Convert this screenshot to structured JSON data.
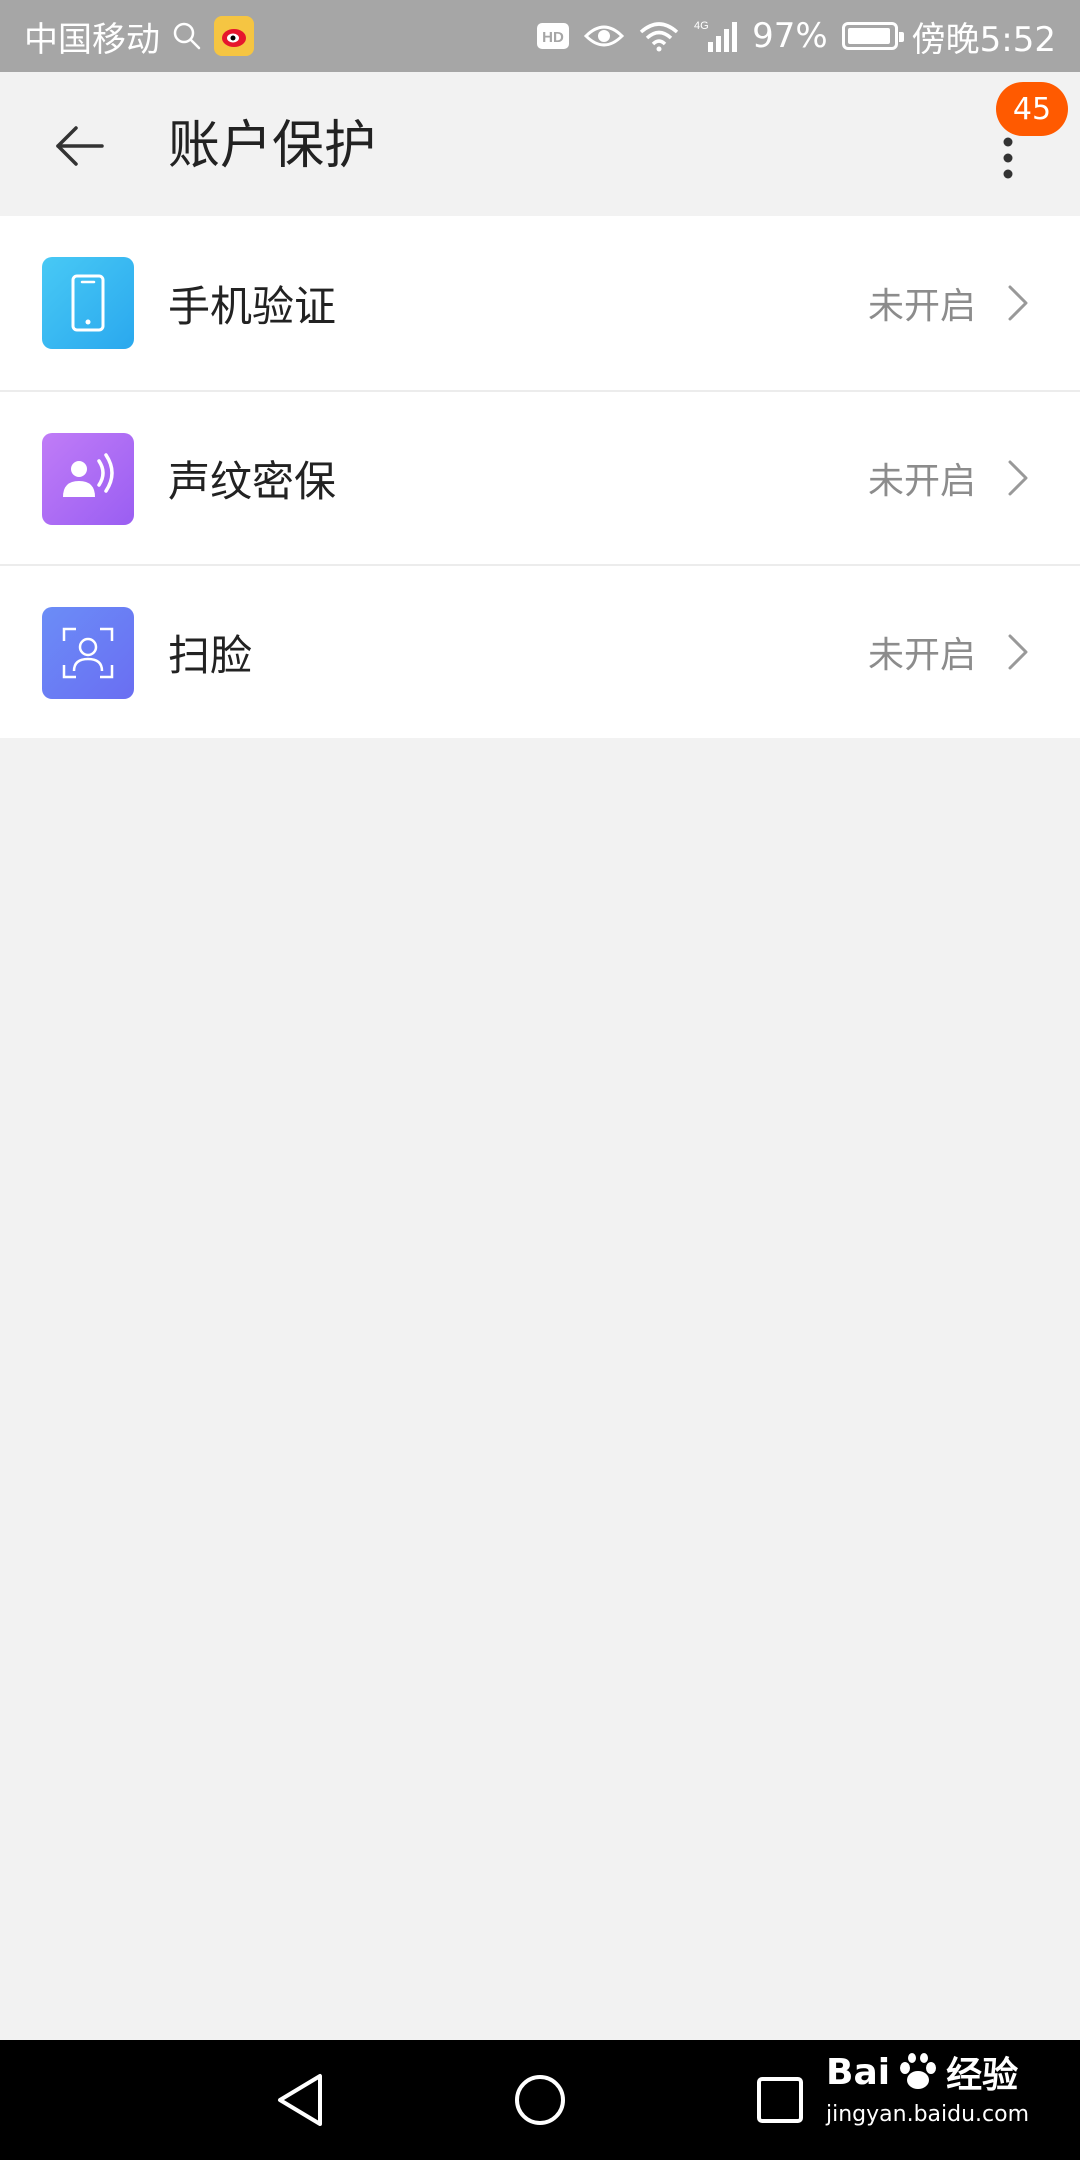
{
  "status_bar": {
    "carrier": "中国移动",
    "hd_label": "HD",
    "network": "4G",
    "battery": "97%",
    "battery_level": 0.97,
    "time": "傍晚5:52"
  },
  "header": {
    "title": "账户保护",
    "badge_count": "45"
  },
  "items": [
    {
      "label": "手机验证",
      "status": "未开启",
      "icon": "phone-icon",
      "color": "#3cb9f0"
    },
    {
      "label": "声纹密保",
      "status": "未开启",
      "icon": "voiceprint-icon",
      "color": "#a067f5"
    },
    {
      "label": "扫脸",
      "status": "未开启",
      "icon": "face-scan-icon",
      "color": "#6a7ef5"
    }
  ],
  "watermark": {
    "brand": "Bai",
    "brand_suffix": "经验",
    "url": "jingyan.baidu.com"
  },
  "colors": {
    "badge": "#ff5a00",
    "background": "#f2f2f2",
    "status_bar": "#a6a6a6"
  }
}
